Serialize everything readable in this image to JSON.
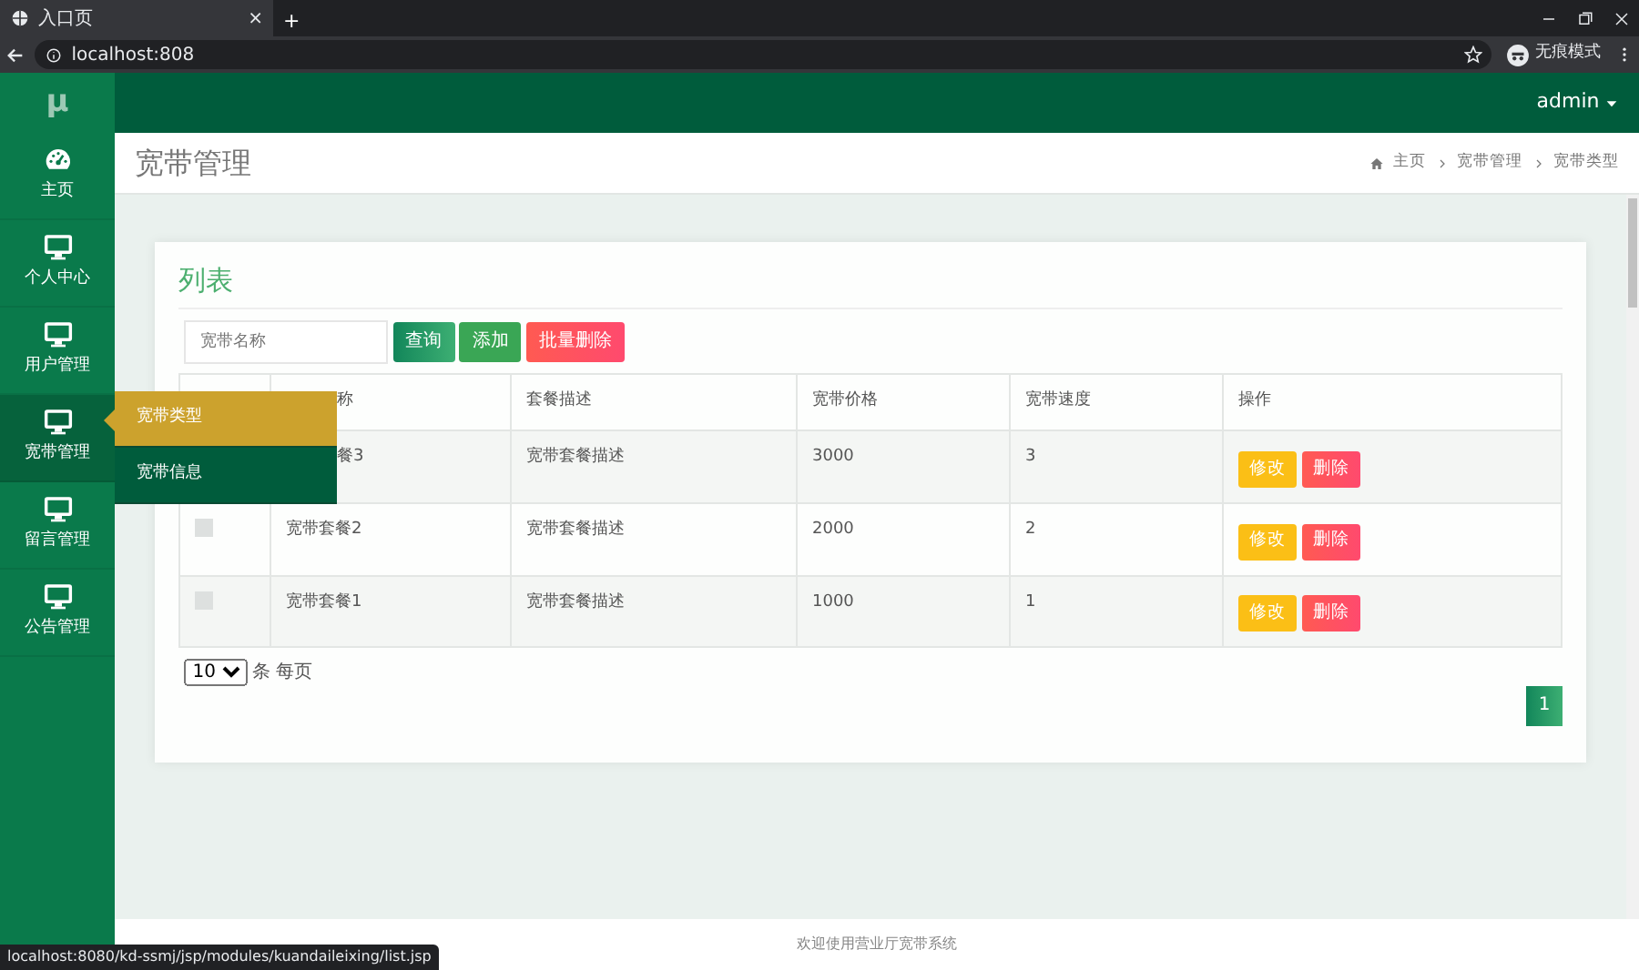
{
  "browser": {
    "tab_title": "入口页",
    "tab_close": "×",
    "new_tab": "+",
    "address": "localhost:808",
    "incognito_label": "无痕模式",
    "status_url": "localhost:8080/kd-ssmj/jsp/modules/kuandaileixing/list.jsp"
  },
  "sidebar": {
    "logo": "μ",
    "items": [
      {
        "label": "主页",
        "expanded": false
      },
      {
        "label": "个人中心",
        "expanded": false
      },
      {
        "label": "用户管理",
        "expanded": false
      },
      {
        "label": "宽带管理",
        "expanded": true
      },
      {
        "label": "留言管理",
        "expanded": false
      },
      {
        "label": "公告管理",
        "expanded": false
      }
    ],
    "flyout": [
      {
        "label": "宽带类型",
        "selected": true
      },
      {
        "label": "宽带信息",
        "selected": false
      }
    ]
  },
  "topbar": {
    "user": "admin"
  },
  "page_header": {
    "title": "宽带管理",
    "breadcrumb": [
      "主页",
      "宽带管理",
      "宽带类型"
    ]
  },
  "card": {
    "title": "列表",
    "search": {
      "placeholder": "宽带名称"
    },
    "buttons": [
      {
        "label": "查询",
        "kind": "search"
      },
      {
        "label": "添加",
        "kind": "add"
      },
      {
        "label": "批量删除",
        "kind": "delete"
      }
    ],
    "table": {
      "header_covered": true,
      "columns": [
        "称",
        "套餐描述",
        "宽带价格",
        "宽带速度",
        "操作"
      ],
      "rows": [
        {
          "covered": true,
          "cells": [
            "餐3",
            "宽带套餐描述",
            "3000",
            "3"
          ],
          "actions": [
            {
              "label": "修改",
              "kind": "edit"
            },
            {
              "label": "删除",
              "kind": "delete"
            }
          ]
        },
        {
          "covered": false,
          "checked": false,
          "cells": [
            "宽带套餐2",
            "宽带套餐描述",
            "2000",
            "2"
          ],
          "actions": [
            {
              "label": "修改",
              "kind": "edit"
            },
            {
              "label": "删除",
              "kind": "delete"
            }
          ]
        },
        {
          "covered": false,
          "checked": false,
          "cells": [
            "宽带套餐1",
            "宽带套餐描述",
            "1000",
            "1"
          ],
          "actions": [
            {
              "label": "修改",
              "kind": "edit"
            },
            {
              "label": "删除",
              "kind": "delete"
            }
          ]
        }
      ]
    },
    "page_size": "10",
    "page_size_label": "条 每页",
    "pages": [
      {
        "label": "1",
        "selected": true
      }
    ]
  },
  "footer": "欢迎使用营业厅宽带系统"
}
